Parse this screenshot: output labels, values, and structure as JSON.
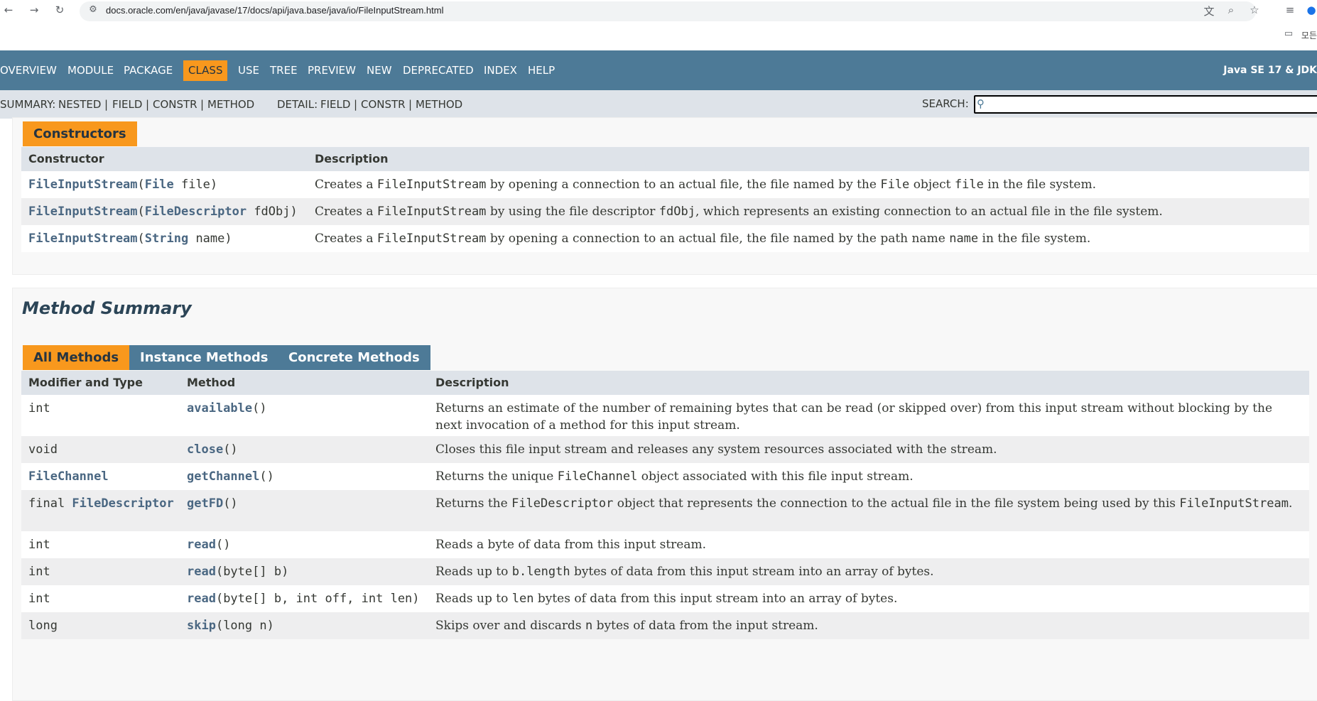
{
  "browser": {
    "url": "docs.oracle.com/en/java/javase/17/docs/api/java.base/java/io/FileInputStream.html",
    "bookmark_label": "모든"
  },
  "nav": {
    "items": [
      "OVERVIEW",
      "MODULE",
      "PACKAGE",
      "CLASS",
      "USE",
      "TREE",
      "PREVIEW",
      "NEW",
      "DEPRECATED",
      "INDEX",
      "HELP"
    ],
    "active": "CLASS",
    "version": "Java SE 17 & JDK"
  },
  "subnav": {
    "summary_label": "SUMMARY:",
    "summary_nested": "NESTED",
    "summary_field": "FIELD",
    "summary_constr": "CONSTR",
    "summary_method": "METHOD",
    "detail_label": "DETAIL:",
    "detail_field": "FIELD",
    "detail_constr": "CONSTR",
    "detail_method": "METHOD",
    "sep": "|",
    "search_label": "SEARCH:",
    "search_value": ""
  },
  "constructors": {
    "caption": "Constructors",
    "col_constructor": "Constructor",
    "col_description": "Description",
    "rows": [
      {
        "name": "FileInputStream",
        "paren_open": "(",
        "ptype": "File",
        "pname": " file)",
        "desc": [
          {
            "t": "Creates a "
          },
          {
            "c": "FileInputStream"
          },
          {
            "t": " by opening a connection to an actual file, the file named by the "
          },
          {
            "c": "File"
          },
          {
            "t": " object "
          },
          {
            "c": "file"
          },
          {
            "t": " in the file system."
          }
        ]
      },
      {
        "name": "FileInputStream",
        "paren_open": "(",
        "ptype": "FileDescriptor",
        "pname": " fdObj)",
        "desc": [
          {
            "t": "Creates a "
          },
          {
            "c": "FileInputStream"
          },
          {
            "t": " by using the file descriptor "
          },
          {
            "c": "fdObj"
          },
          {
            "t": ", which represents an existing connection to an actual file in the file system."
          }
        ]
      },
      {
        "name": "FileInputStream",
        "paren_open": "(",
        "ptype": "String",
        "pname": " name)",
        "desc": [
          {
            "t": "Creates a "
          },
          {
            "c": "FileInputStream"
          },
          {
            "t": " by opening a connection to an actual file, the file named by the path name "
          },
          {
            "c": "name"
          },
          {
            "t": " in the file system."
          }
        ]
      }
    ]
  },
  "methods": {
    "title": "Method Summary",
    "tabs": [
      "All Methods",
      "Instance Methods",
      "Concrete Methods"
    ],
    "active_tab": "All Methods",
    "col_modifier": "Modifier and Type",
    "col_method": "Method",
    "col_description": "Description",
    "rows": [
      {
        "mod_pre": "",
        "mod_link": "",
        "mod": "int",
        "name": "available",
        "sig": "()",
        "desc": [
          {
            "t": "Returns an estimate of the number of remaining bytes that can be read (or skipped over) from this input stream without blocking by the next invocation of a method for this input stream."
          }
        ]
      },
      {
        "mod_pre": "",
        "mod_link": "",
        "mod": "void",
        "name": "close",
        "sig": "()",
        "desc": [
          {
            "t": "Closes this file input stream and releases any system resources associated with the stream."
          }
        ]
      },
      {
        "mod_pre": "",
        "mod_link": "FileChannel",
        "mod": "",
        "name": "getChannel",
        "sig": "()",
        "desc": [
          {
            "t": "Returns the unique "
          },
          {
            "c": "FileChannel"
          },
          {
            "t": " object associated with this file input stream."
          }
        ]
      },
      {
        "mod_pre": "final ",
        "mod_link": "FileDescriptor",
        "mod": "",
        "name": "getFD",
        "sig": "()",
        "desc": [
          {
            "t": "Returns the "
          },
          {
            "c": "FileDescriptor"
          },
          {
            "t": " object that represents the connection to the actual file in the file system being used by this "
          },
          {
            "c": "FileInputStream"
          },
          {
            "t": "."
          }
        ]
      },
      {
        "mod_pre": "",
        "mod_link": "",
        "mod": "int",
        "name": "read",
        "sig": "()",
        "desc": [
          {
            "t": "Reads a byte of data from this input stream."
          }
        ]
      },
      {
        "mod_pre": "",
        "mod_link": "",
        "mod": "int",
        "name": "read",
        "sig": "(byte[] b)",
        "desc": [
          {
            "t": "Reads up to "
          },
          {
            "c": "b.length"
          },
          {
            "t": " bytes of data from this input stream into an array of bytes."
          }
        ]
      },
      {
        "mod_pre": "",
        "mod_link": "",
        "mod": "int",
        "name": "read",
        "sig": "(byte[] b, int off, int len)",
        "desc": [
          {
            "t": "Reads up to "
          },
          {
            "c": "len"
          },
          {
            "t": " bytes of data from this input stream into an array of bytes."
          }
        ]
      },
      {
        "mod_pre": "",
        "mod_link": "",
        "mod": "long",
        "name": "skip",
        "sig": "(long n)",
        "desc": [
          {
            "t": "Skips over and discards "
          },
          {
            "c": "n"
          },
          {
            "t": " bytes of data from the input stream."
          }
        ]
      }
    ]
  }
}
